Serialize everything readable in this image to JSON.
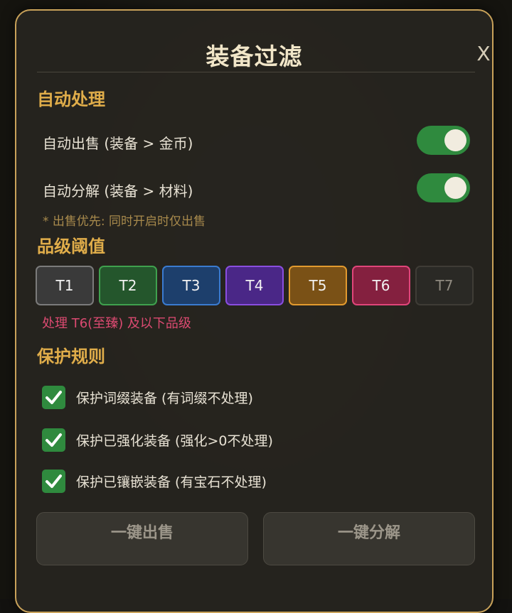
{
  "dialog": {
    "title": "装备过滤",
    "close_label": "X"
  },
  "auto_process": {
    "title": "自动处理",
    "auto_sell": {
      "label": "自动出售 (装备 > 金币)",
      "enabled": true
    },
    "auto_salvage": {
      "label": "自动分解 (装备 > 材料)",
      "enabled": true
    },
    "note": "* 出售优先: 同时开启时仅出售"
  },
  "tier_threshold": {
    "title": "品级阈值",
    "tiers": [
      {
        "label": "T1",
        "bg": "#3a3a3a",
        "border": "#7b7b7b"
      },
      {
        "label": "T2",
        "bg": "#24562c",
        "border": "#3fa14e"
      },
      {
        "label": "T3",
        "bg": "#1d3f6c",
        "border": "#3a7bd0"
      },
      {
        "label": "T4",
        "bg": "#4a2787",
        "border": "#8a4ee0"
      },
      {
        "label": "T5",
        "bg": "#7a5116",
        "border": "#e29a2e"
      },
      {
        "label": "T6",
        "bg": "#84203f",
        "border": "#e0457a"
      },
      {
        "label": "T7",
        "bg": "#2a2925",
        "border": "#3f3c36"
      }
    ],
    "selected": "T6",
    "description": "处理 T6(至臻) 及以下品级"
  },
  "protection": {
    "title": "保护规则",
    "rules": [
      {
        "label": "保护词缀装备 (有词缀不处理)",
        "checked": true
      },
      {
        "label": "保护已强化装备 (强化>0不处理)",
        "checked": true
      },
      {
        "label": "保护已镶嵌装备 (有宝石不处理)",
        "checked": true
      }
    ]
  },
  "actions": {
    "sell_all": "一键出售",
    "salvage_all": "一键分解"
  },
  "colors": {
    "accent_gold": "#e0ad4a",
    "panel_border": "#c9a25a",
    "toggle_on": "#2f8a3e",
    "warning_text": "#dc4a71"
  }
}
